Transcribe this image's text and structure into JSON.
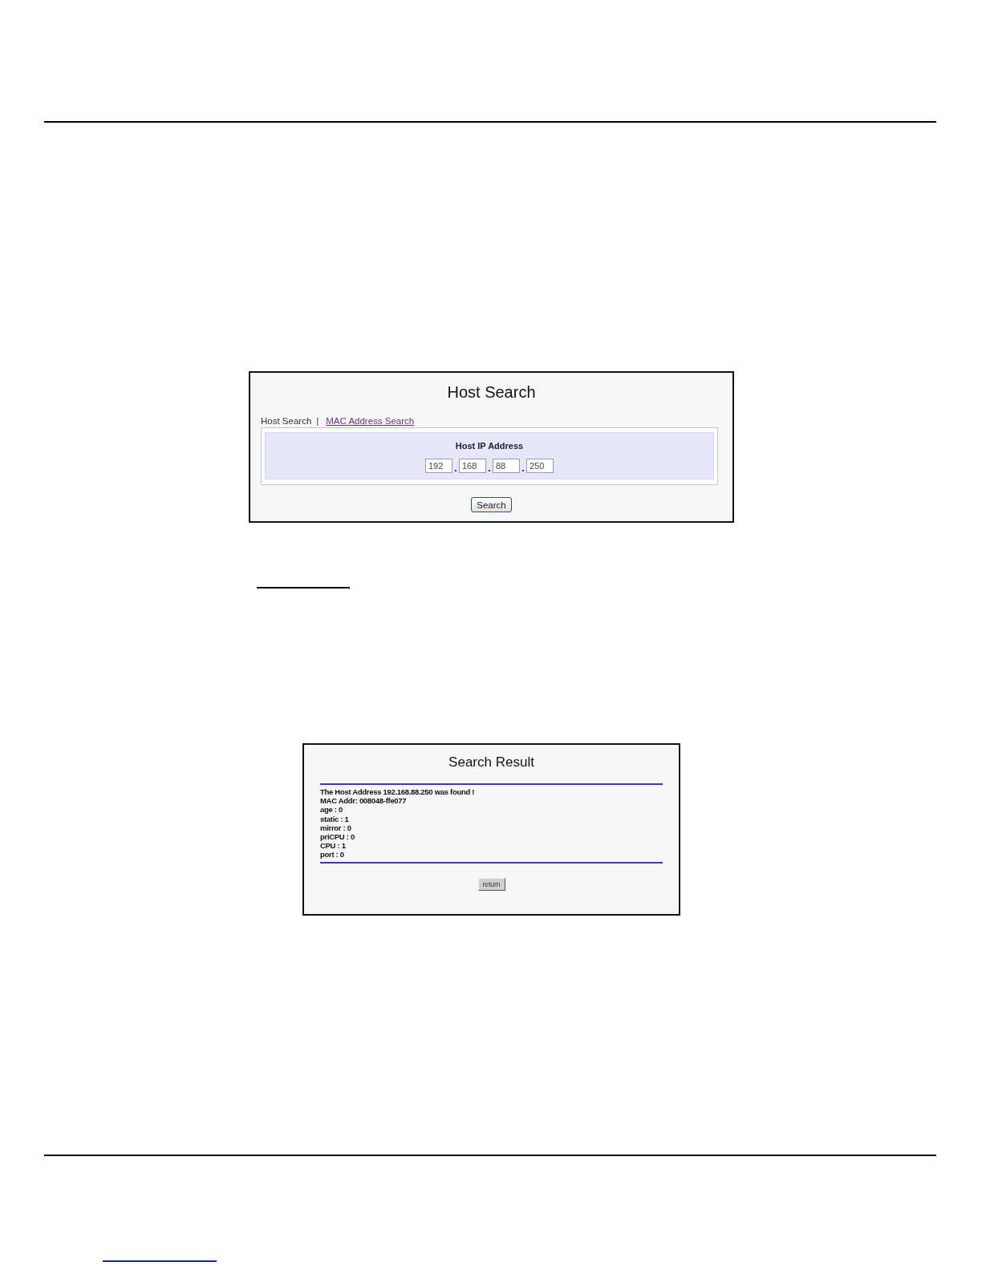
{
  "host_search": {
    "title": "Host Search",
    "nav": [
      {
        "label": "Host Search",
        "selected": true
      },
      {
        "label": "MAC Address Search",
        "selected": false
      }
    ],
    "nav_separator": "|",
    "ip_address": {
      "label": "Host IP Address",
      "octets": [
        "192",
        "168",
        "88",
        "250"
      ],
      "separator": "."
    },
    "button": "Search"
  },
  "search_result": {
    "title": "Search Result",
    "lines": [
      "The Host Address 192.168.88.250 was found !",
      "MAC Addr: 008048-ffe077",
      "age : 0",
      "static : 1",
      "mirror : 0",
      "priCPU : 0",
      "CPU : 1",
      "port : 0"
    ],
    "button": "return"
  }
}
